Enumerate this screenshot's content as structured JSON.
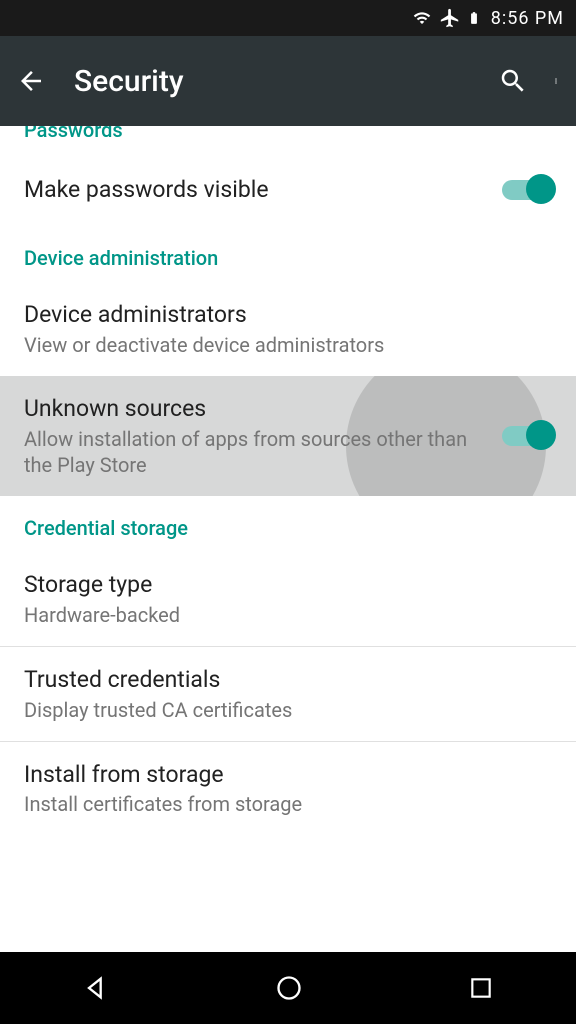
{
  "status": {
    "time": "8:56 PM"
  },
  "header": {
    "title": "Security"
  },
  "sections": {
    "passwords": {
      "label": "Passwords",
      "make_visible": {
        "title": "Make passwords visible"
      }
    },
    "device_admin": {
      "label": "Device administration",
      "administrators": {
        "title": "Device administrators",
        "subtitle": "View or deactivate device administrators"
      },
      "unknown_sources": {
        "title": "Unknown sources",
        "subtitle": "Allow installation of apps from sources other than the Play Store"
      }
    },
    "credential": {
      "label": "Credential storage",
      "storage_type": {
        "title": "Storage type",
        "subtitle": "Hardware-backed"
      },
      "trusted": {
        "title": "Trusted credentials",
        "subtitle": "Display trusted CA certificates"
      },
      "install": {
        "title": "Install from storage",
        "subtitle": "Install certificates from storage"
      }
    }
  }
}
